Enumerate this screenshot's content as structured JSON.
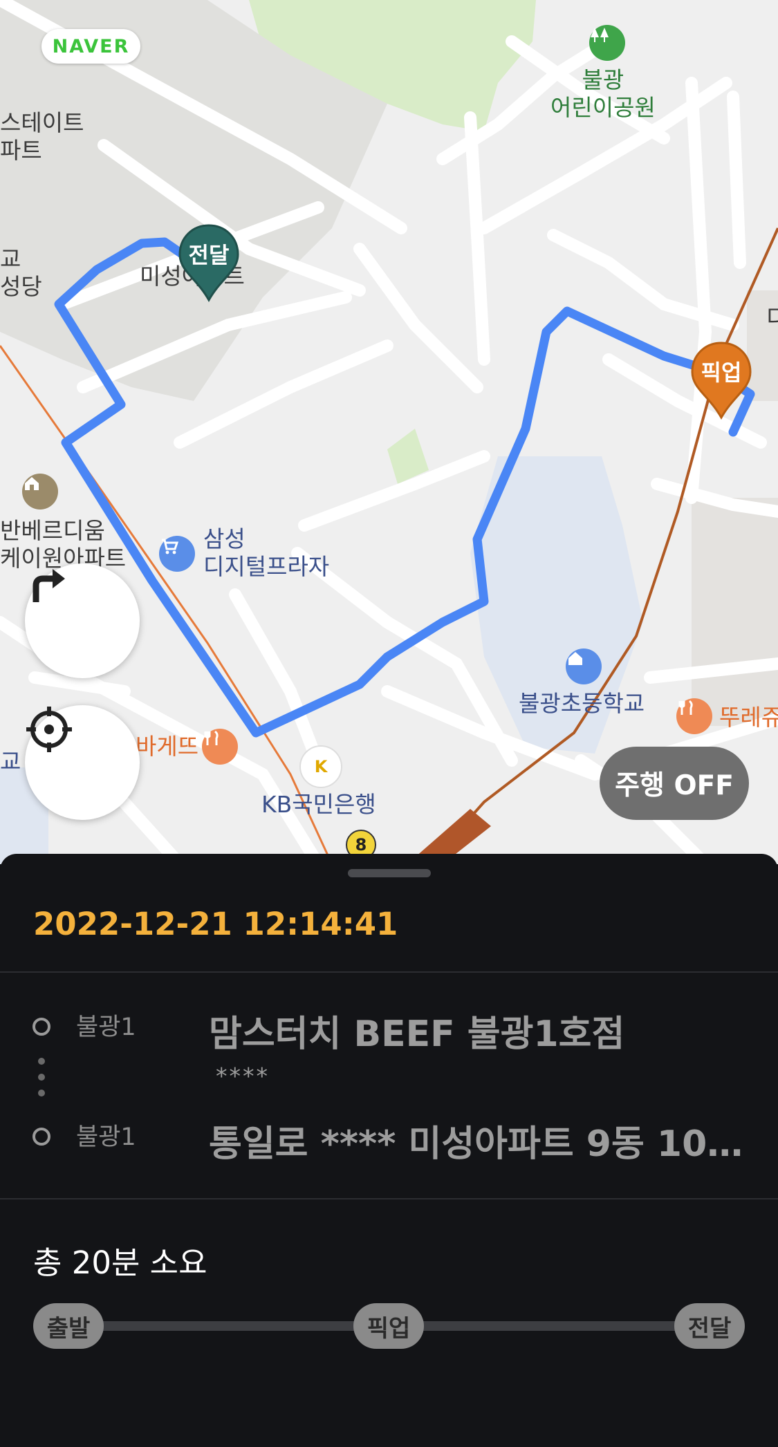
{
  "map": {
    "provider_logo": "NAVER",
    "labels": {
      "park": "불광\n어린이공원",
      "estate": "스테이트\n파트",
      "church": "교\n성당",
      "misung": "미성아파트",
      "vanberg": "반베르디움\n케이원아파트",
      "digital_plaza": "삼성\n디지털프라자",
      "school": "불광초등학교",
      "kb_bank": "KB국민은행",
      "restaurant_left": "바게뜨",
      "restaurant_right": "뚜레쥬",
      "edge_right": "디",
      "edge_left": "교",
      "bus_number": "8"
    },
    "pins": {
      "delivery": "전달",
      "pickup": "픽업"
    },
    "route_color": "#4a86f5",
    "delivery_pin_color": "#2a6a64",
    "pickup_pin_color": "#e07820"
  },
  "controls": {
    "turn_button_icon": "turn-right-arrow-icon",
    "locate_button_icon": "crosshair-icon",
    "drive_toggle_label": "주행 OFF"
  },
  "sheet": {
    "datetime": "2022-12-21 12:14:41",
    "stops": [
      {
        "area": "불광1",
        "title": "맘스터치 BEEF 불광1호점",
        "sub": "****"
      },
      {
        "area": "불광1",
        "title": "통일로 **** 미성아파트 9동 10…",
        "sub": ""
      }
    ],
    "total_time": "총 20분 소요",
    "progress_steps": [
      "출발",
      "픽업",
      "전달"
    ],
    "accent_color": "#f4b13c"
  }
}
